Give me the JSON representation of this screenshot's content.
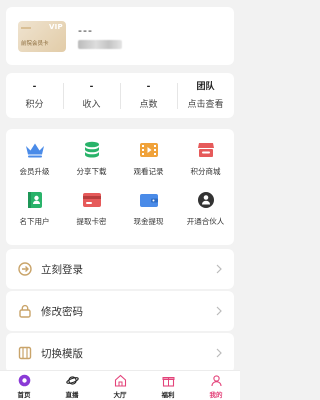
{
  "member": {
    "card_mark": "VIP",
    "card_label": "前院会员卡",
    "name": "---"
  },
  "stats": [
    {
      "value": "-",
      "label": "积分"
    },
    {
      "value": "-",
      "label": "收入"
    },
    {
      "value": "-",
      "label": "点数"
    },
    {
      "value": "团队",
      "label": "点击查看"
    }
  ],
  "grid": [
    {
      "label": "会员升级",
      "icon": "crown-icon"
    },
    {
      "label": "分享下载",
      "icon": "database-icon"
    },
    {
      "label": "观看记录",
      "icon": "film-icon"
    },
    {
      "label": "积分商城",
      "icon": "shop-icon"
    },
    {
      "label": "名下用户",
      "icon": "user-book-icon"
    },
    {
      "label": "提取卡密",
      "icon": "card-icon"
    },
    {
      "label": "现金提现",
      "icon": "wallet-icon"
    },
    {
      "label": "开通合伙人",
      "icon": "partner-icon"
    }
  ],
  "menu": [
    {
      "label": "立刻登录",
      "icon": "login-icon"
    },
    {
      "label": "修改密码",
      "icon": "lock-icon"
    },
    {
      "label": "切换模版",
      "icon": "template-icon"
    }
  ],
  "tabs": [
    {
      "label": "首页",
      "icon": "home-icon"
    },
    {
      "label": "直播",
      "icon": "planet-icon"
    },
    {
      "label": "大厅",
      "icon": "hall-icon"
    },
    {
      "label": "福利",
      "icon": "gift-icon"
    },
    {
      "label": "我的",
      "icon": "profile-icon",
      "active": true
    }
  ],
  "colors": {
    "accent": "#e3437a",
    "crown": "#4a8be8",
    "green": "#29b36a",
    "orange": "#f0a23a",
    "red": "#e65a5a",
    "gold": "#c9a46a"
  }
}
